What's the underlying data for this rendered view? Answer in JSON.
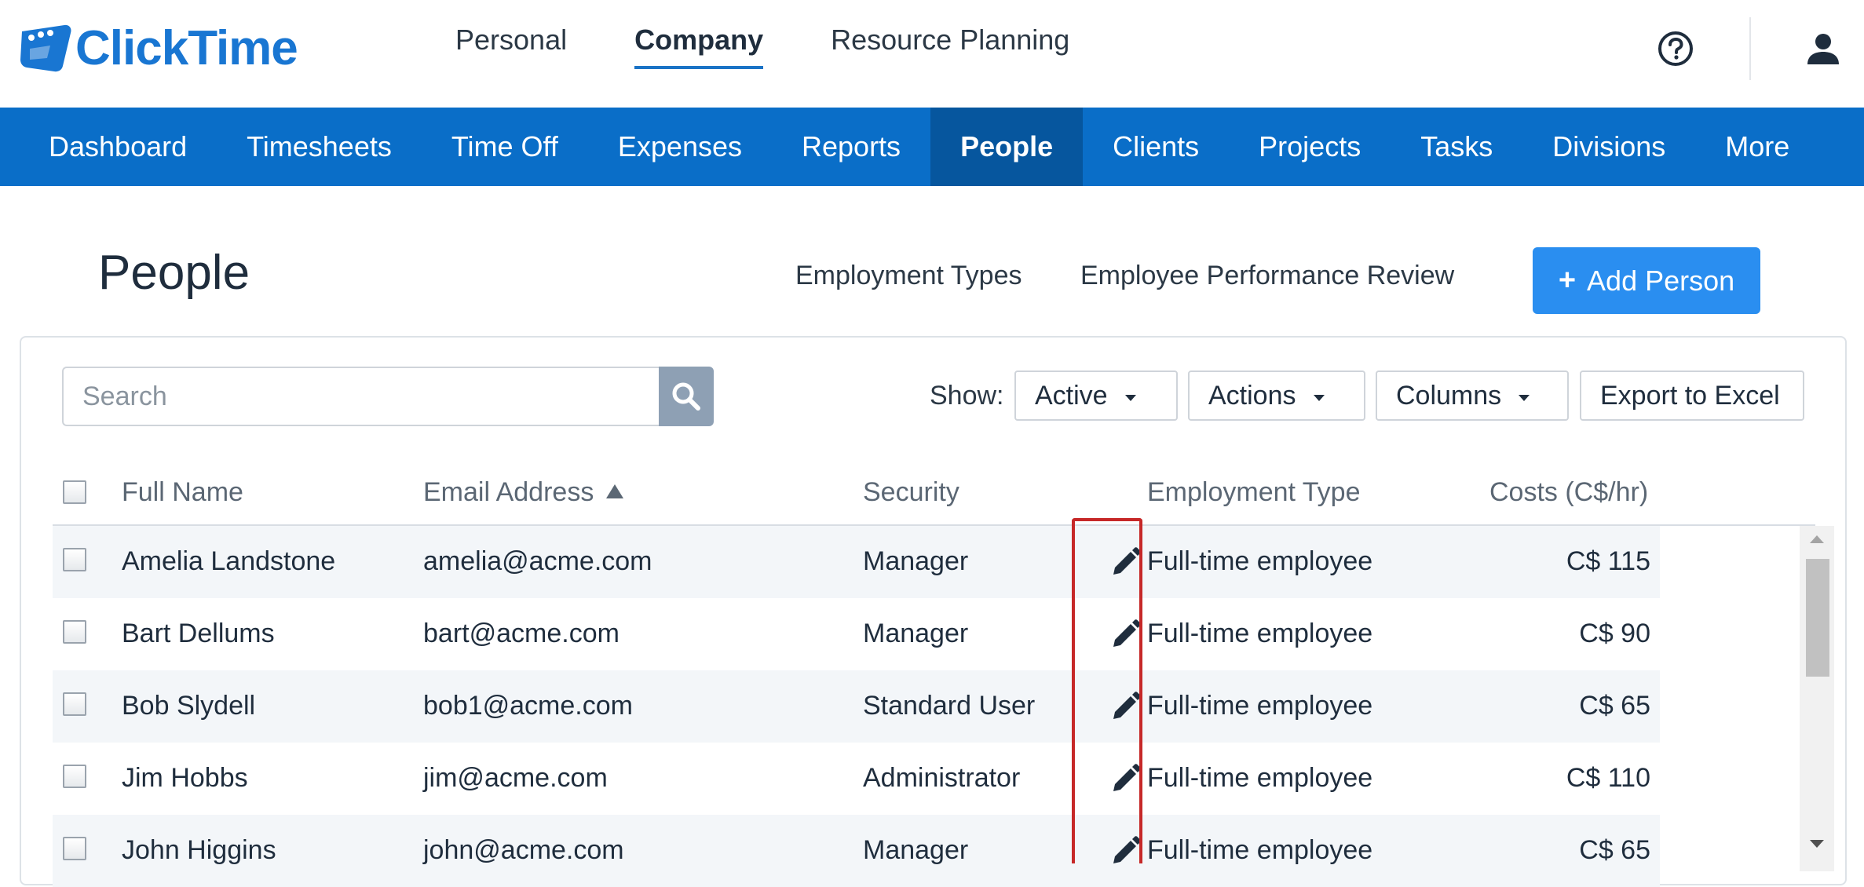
{
  "app": {
    "logo_text": "ClickTime",
    "brand_color": "#1976d2"
  },
  "top_nav": {
    "items": [
      {
        "label": "Personal",
        "active": false
      },
      {
        "label": "Company",
        "active": true
      },
      {
        "label": "Resource Planning",
        "active": false
      }
    ],
    "help_icon": "help-circle-icon",
    "user_icon": "user-icon"
  },
  "main_nav": {
    "color": "#0a6ec8",
    "items": [
      {
        "label": "Dashboard"
      },
      {
        "label": "Timesheets"
      },
      {
        "label": "Time Off"
      },
      {
        "label": "Expenses"
      },
      {
        "label": "Reports"
      },
      {
        "label": "People",
        "active": true
      },
      {
        "label": "Clients"
      },
      {
        "label": "Projects"
      },
      {
        "label": "Tasks"
      },
      {
        "label": "Divisions"
      },
      {
        "label": "More"
      }
    ]
  },
  "page": {
    "title": "People",
    "links": [
      "Employment Types",
      "Employee Performance Review"
    ],
    "add_button": {
      "plus": "+",
      "label": "Add Person",
      "color": "#2a8ef0"
    }
  },
  "toolbar": {
    "search_placeholder": "Search",
    "search_value": "",
    "show_label": "Show:",
    "show_filter": "Active",
    "actions_label": "Actions",
    "columns_label": "Columns",
    "export_label": "Export to Excel"
  },
  "table": {
    "columns": {
      "full_name": "Full Name",
      "email": "Email Address",
      "security": "Security",
      "employment_type": "Employment Type",
      "costs": "Costs (C$/hr)"
    },
    "sort": {
      "column": "Email Address",
      "direction": "ascending"
    },
    "rows": [
      {
        "name": "Amelia Landstone",
        "email": "amelia@acme.com",
        "security": "Manager",
        "employment_type": "Full-time employee",
        "cost": "C$ 115"
      },
      {
        "name": "Bart Dellums",
        "email": "bart@acme.com",
        "security": "Manager",
        "employment_type": "Full-time employee",
        "cost": "C$ 90"
      },
      {
        "name": "Bob Slydell",
        "email": "bob1@acme.com",
        "security": "Standard User",
        "employment_type": "Full-time employee",
        "cost": "C$ 65"
      },
      {
        "name": "Jim Hobbs",
        "email": "jim@acme.com",
        "security": "Administrator",
        "employment_type": "Full-time employee",
        "cost": "C$ 110"
      },
      {
        "name": "John Higgins",
        "email": "john@acme.com",
        "security": "Manager",
        "employment_type": "Full-time employee",
        "cost": "C$ 65"
      }
    ],
    "edit_icon": "pencil-icon",
    "highlight_color": "#c62828"
  }
}
